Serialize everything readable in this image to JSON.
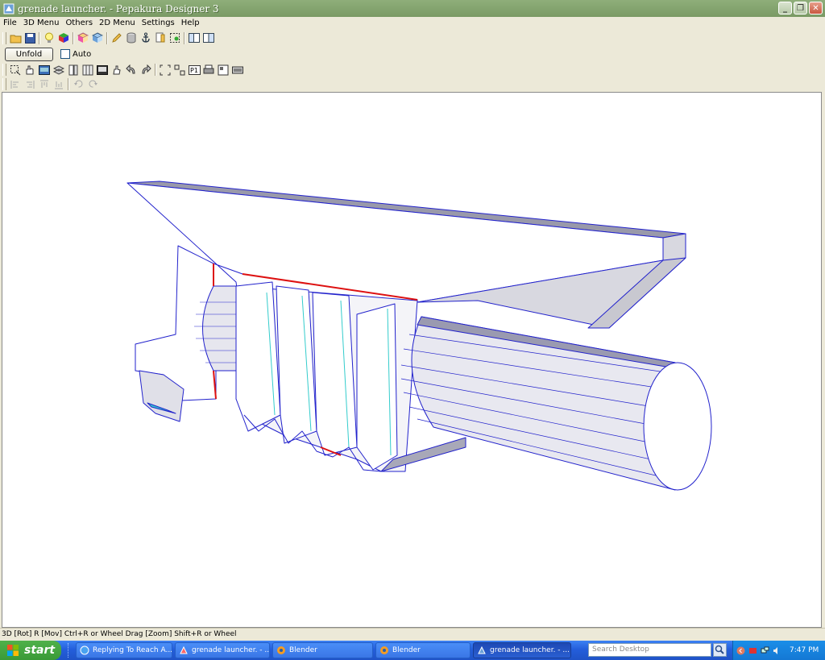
{
  "window": {
    "title": "grenade launcher. - Pepakura Designer 3"
  },
  "menu": [
    "File",
    "3D Menu",
    "Others",
    "2D Menu",
    "Settings",
    "Help"
  ],
  "toolbar": {
    "unfold_label": "Unfold",
    "auto_label": "Auto"
  },
  "status": {
    "text": "3D [Rot] R [Mov] Ctrl+R or Wheel Drag [Zoom] Shift+R or Wheel"
  },
  "taskbar": {
    "start_label": "start",
    "items": [
      {
        "label": "Replying To Reach A..."
      },
      {
        "label": "grenade launcher. - ..."
      },
      {
        "label": "Blender"
      },
      {
        "label": "Blender"
      },
      {
        "label": "grenade launcher. - ..."
      }
    ],
    "search_placeholder": "Search Desktop",
    "clock": "7:47 PM"
  },
  "colors": {
    "edge": "#2222cc",
    "cut": "#dd1111",
    "fold": "#33cccc"
  }
}
